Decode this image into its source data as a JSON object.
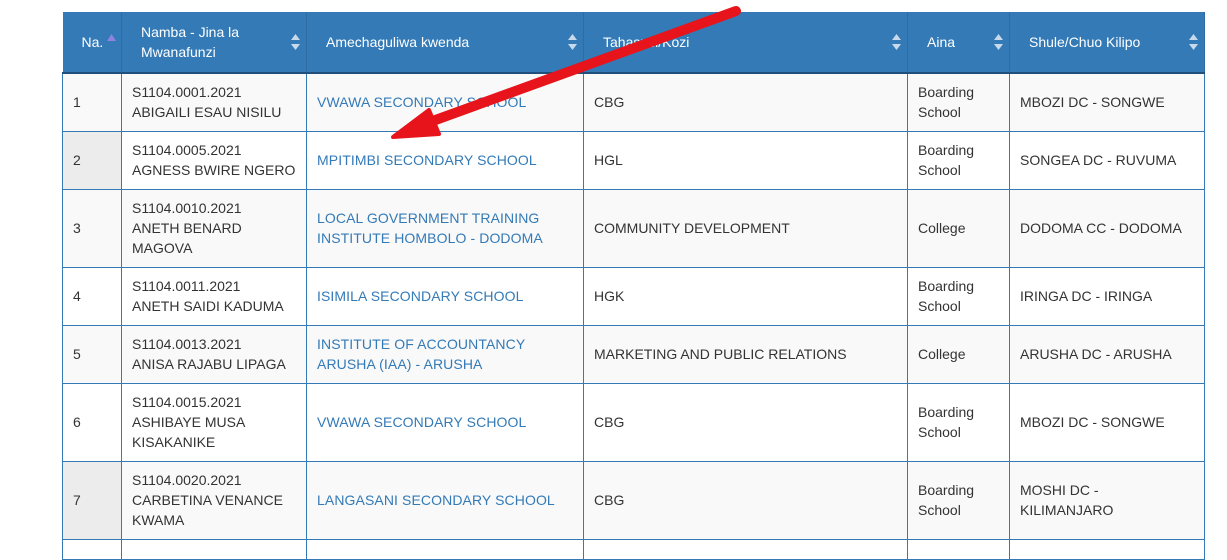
{
  "columns": [
    {
      "label": "Na."
    },
    {
      "label": "Namba - Jina la Mwanafunzi"
    },
    {
      "label": "Amechaguliwa kwenda"
    },
    {
      "label": "Tahasusi/Kozi"
    },
    {
      "label": "Aina"
    },
    {
      "label": "Shule/Chuo Kilipo"
    }
  ],
  "rows": [
    {
      "no": "1",
      "number": "S1104.0001.2021",
      "name": "ABIGAILI ESAU NISILU",
      "school": "VWAWA SECONDARY SCHOOL",
      "course": "CBG",
      "type": "Boarding School",
      "location": "MBOZI DC - SONGWE"
    },
    {
      "no": "2",
      "number": "S1104.0005.2021",
      "name": "AGNESS BWIRE NGERO",
      "school": "MPITIMBI SECONDARY SCHOOL",
      "course": "HGL",
      "type": "Boarding School",
      "location": "SONGEA DC - RUVUMA"
    },
    {
      "no": "3",
      "number": "S1104.0010.2021",
      "name": "ANETH BENARD MAGOVA",
      "school": "LOCAL GOVERNMENT TRAINING INSTITUTE HOMBOLO - DODOMA",
      "course": "COMMUNITY DEVELOPMENT",
      "type": "College",
      "location": "DODOMA CC - DODOMA"
    },
    {
      "no": "4",
      "number": "S1104.0011.2021",
      "name": "ANETH SAIDI KADUMA",
      "school": "ISIMILA SECONDARY SCHOOL",
      "course": "HGK",
      "type": "Boarding School",
      "location": "IRINGA DC - IRINGA"
    },
    {
      "no": "5",
      "number": "S1104.0013.2021",
      "name": "ANISA RAJABU LIPAGA",
      "school": "INSTITUTE OF ACCOUNTANCY ARUSHA (IAA) - ARUSHA",
      "course": "MARKETING AND PUBLIC RELATIONS",
      "type": "College",
      "location": "ARUSHA DC - ARUSHA"
    },
    {
      "no": "6",
      "number": "S1104.0015.2021",
      "name": "ASHIBAYE MUSA KISAKANIKE",
      "school": "VWAWA SECONDARY SCHOOL",
      "course": "CBG",
      "type": "Boarding School",
      "location": "MBOZI DC - SONGWE"
    },
    {
      "no": "7",
      "number": "S1104.0020.2021",
      "name": "CARBETINA VENANCE KWAMA",
      "school": "LANGASANI SECONDARY SCHOOL",
      "course": "CBG",
      "type": "Boarding School",
      "location": "MOSHI DC - KILIMANJARO"
    },
    {
      "no": "",
      "number": "",
      "name": "",
      "school": "",
      "course": "",
      "type": "",
      "location": ""
    }
  ],
  "colors": {
    "header_bg": "#337ab7",
    "link": "#337ab7",
    "annotation_arrow": "#e8141b"
  },
  "icons": {
    "sort": "sort-both-icon",
    "sort_asc": "sort-asc-icon",
    "annotation": "red-arrow-annotation"
  }
}
